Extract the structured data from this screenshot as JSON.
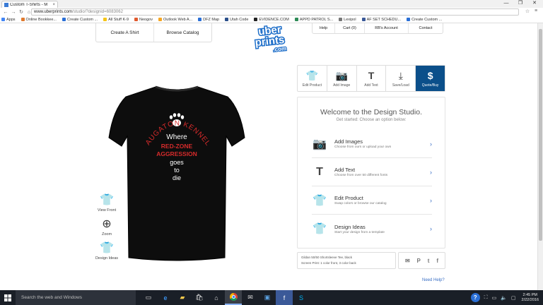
{
  "browser": {
    "tab_title": "Custom T-Shirts - M",
    "tab_close": "×",
    "url_host": "www.uberprints.com",
    "url_path": "/studio/?designid=6083062",
    "window_controls": [
      "—",
      "❐",
      "✕"
    ]
  },
  "bookmarks": [
    {
      "label": "Apps",
      "color": "#4285f4"
    },
    {
      "label": "Online Bookkee...",
      "color": "#e07a2e"
    },
    {
      "label": "Create Custom ...",
      "color": "#2a6fd6"
    },
    {
      "label": "All Stuff K-9",
      "color": "#f5c518"
    },
    {
      "label": "Neogov",
      "color": "#e05a2e"
    },
    {
      "label": "Outlook Web A...",
      "color": "#f5a623"
    },
    {
      "label": "DFZ Map",
      "color": "#2a6fd6"
    },
    {
      "label": "Utah Code",
      "color": "#2a4f8a"
    },
    {
      "label": "EVIDENCE.COM",
      "color": "#222222"
    },
    {
      "label": "APPD PATROL S...",
      "color": "#2e8b57"
    },
    {
      "label": "Lexipol",
      "color": "#777777"
    },
    {
      "label": "AF SET SCHEDU...",
      "color": "#3b5998"
    },
    {
      "label": "Create Custom ...",
      "color": "#2a6fd6"
    }
  ],
  "site_nav": {
    "left": [
      "Create A Shirt",
      "Browse Catalog"
    ],
    "right_help": "Help",
    "right_cart": "Cart",
    "right_cart_count": "(0)",
    "right_rb_account": "RB's Account",
    "right_contact": "Contact"
  },
  "logo": {
    "line1": "uber",
    "line2": "prints",
    "line3": ".com"
  },
  "shirt_design": {
    "arc_text": "MAUGATON  KENNELS",
    "lines": [
      "Where",
      "RED-ZONE",
      "AGGRESSION",
      "goes",
      "to",
      "die"
    ],
    "colors": {
      "shirt": "#0d0d0d",
      "red": "#d62b2b",
      "white": "#ffffff"
    }
  },
  "side_tools": [
    {
      "label": "View Front",
      "icon": "tshirt-flip-icon"
    },
    {
      "label": "Zoom",
      "icon": "zoom-in-icon"
    },
    {
      "label": "Design Ideas",
      "icon": "tshirt-ideas-icon"
    }
  ],
  "toolbar": [
    {
      "label": "Edit Product",
      "icon": "tshirt-icon"
    },
    {
      "label": "Add Image",
      "icon": "camera-icon"
    },
    {
      "label": "Add Text",
      "icon": "text-icon"
    },
    {
      "label": "Save/Load",
      "icon": "download-icon"
    },
    {
      "label": "Quote/Buy",
      "icon": "dollar-icon"
    }
  ],
  "welcome": {
    "title": "Welcome to the Design Studio.",
    "subtitle": "Get started:  Choose an option below:",
    "options": [
      {
        "title": "Add Images",
        "desc": "Choose from ours or upload your own",
        "icon": "camera-icon"
      },
      {
        "title": "Add Text",
        "desc": "Choose from over 50 different fonts",
        "icon": "text-icon"
      },
      {
        "title": "Edit Product",
        "desc": "Swap colors or browse our catalog",
        "icon": "tshirt-icon"
      },
      {
        "title": "Design Ideas",
        "desc": "Start your design from a template",
        "icon": "tshirt-ideas-icon"
      }
    ]
  },
  "product_info": {
    "product": "Gildan 50/50 Shortsleeve Tee, black",
    "print": "Screen Print:  1 color front, 3 color back"
  },
  "social_icons": [
    "email-icon",
    "pinterest-icon",
    "twitter-icon",
    "facebook-icon"
  ],
  "need_help": "Need Help?",
  "taskbar": {
    "search_placeholder": "Search the web and Windows",
    "time": "2:45 PM",
    "date": "2/22/2016"
  },
  "accent_color": "#0b4f8a",
  "link_color": "#3a6fc5"
}
